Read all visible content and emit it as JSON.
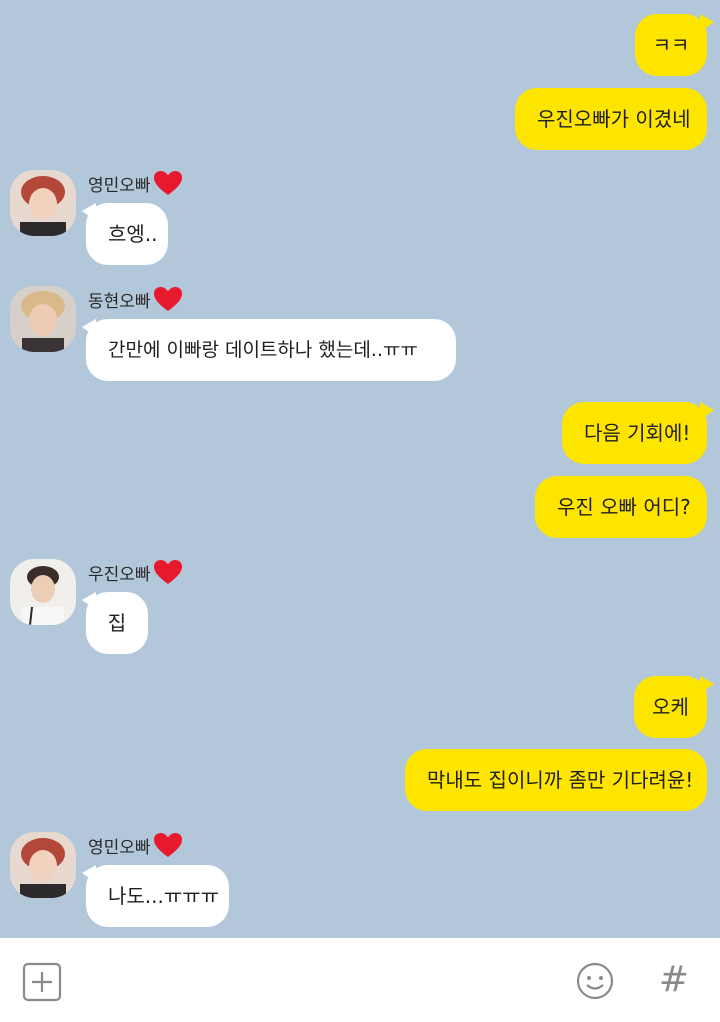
{
  "messages": [
    {
      "sender": "me",
      "text": "ㅋㅋ"
    },
    {
      "sender": "me",
      "text": "우진오빠가 이겼네"
    },
    {
      "sender": "them",
      "name": "영민오빠",
      "text": "흐엥.."
    },
    {
      "sender": "them",
      "name": "동현오빠",
      "text": "간만에 이빠랑 데이트하나 했는데..ㅠㅠ"
    },
    {
      "sender": "me",
      "text": "다음 기회에!"
    },
    {
      "sender": "me",
      "text": "우진 오빠 어디?"
    },
    {
      "sender": "them",
      "name": "우진오빠",
      "text": "집"
    },
    {
      "sender": "me",
      "text": "오케"
    },
    {
      "sender": "me",
      "text": "막내도 집이니까 좀만 기다려윤!"
    },
    {
      "sender": "them",
      "name": "영민오빠",
      "text": "나도...ㅠㅠㅠ"
    }
  ],
  "bottom_bar": {
    "left_icon": "add-icon",
    "emoji_icon": "emoji-icon",
    "hash_label": "#"
  },
  "colors": {
    "background": "#b2c7da",
    "my_bubble": "#fee500",
    "their_bubble": "#ffffff",
    "heart": "#e8192c"
  }
}
